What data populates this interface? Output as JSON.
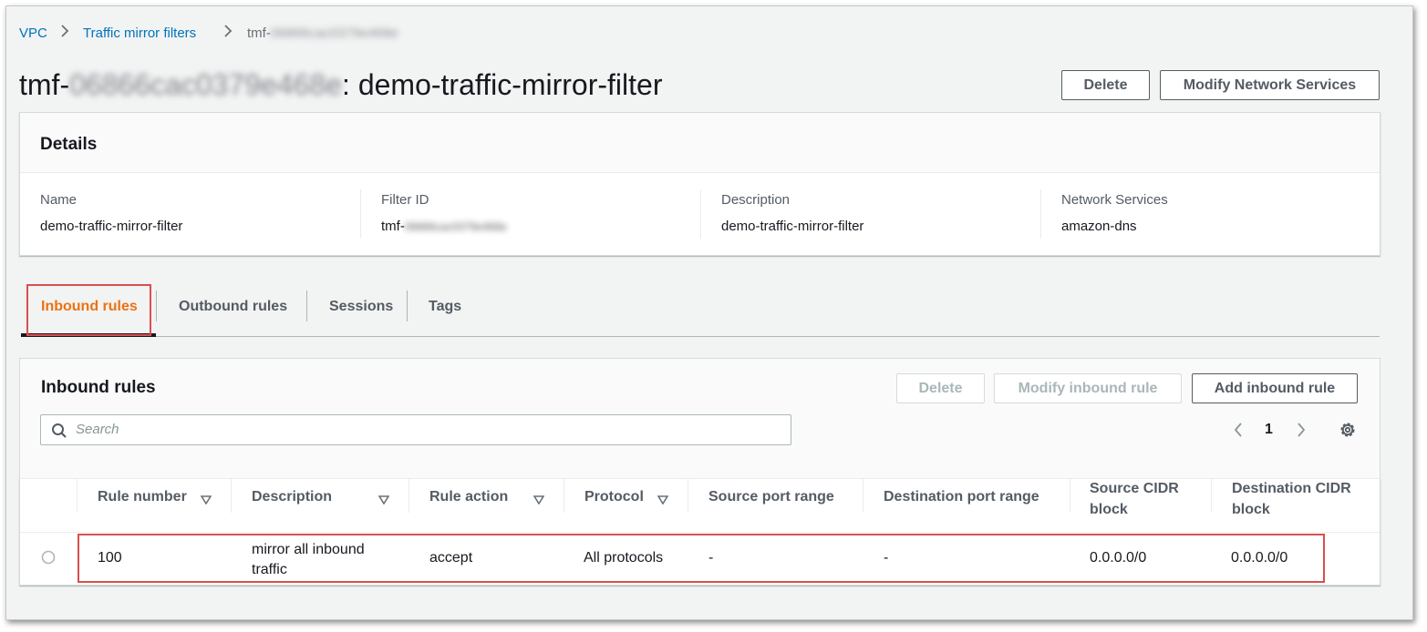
{
  "breadcrumb": {
    "items": [
      "VPC",
      "Traffic mirror filters"
    ],
    "current_prefix": "tmf-",
    "current_redacted": "06866cac0379e468e"
  },
  "header": {
    "title_prefix": "tmf-",
    "title_redacted": "06866cac0379e468e",
    "title_suffix": ": demo-traffic-mirror-filter",
    "delete_label": "Delete",
    "modify_label": "Modify Network Services"
  },
  "details": {
    "title": "Details",
    "fields": [
      {
        "label": "Name",
        "value": "demo-traffic-mirror-filter"
      },
      {
        "label": "Filter ID",
        "value": "tmf-",
        "redacted": "06866cac0379e468e"
      },
      {
        "label": "Description",
        "value": "demo-traffic-mirror-filter"
      },
      {
        "label": "Network Services",
        "value": "amazon-dns"
      }
    ]
  },
  "tabs": [
    {
      "label": "Inbound rules",
      "active": true
    },
    {
      "label": "Outbound rules",
      "active": false
    },
    {
      "label": "Sessions",
      "active": false
    },
    {
      "label": "Tags",
      "active": false
    }
  ],
  "rules": {
    "title": "Inbound rules",
    "delete_label": "Delete",
    "modify_label": "Modify inbound rule",
    "add_label": "Add inbound rule",
    "search_placeholder": "Search",
    "page_number": "1",
    "columns": [
      "Rule number",
      "Description",
      "Rule action",
      "Protocol",
      "Source port range",
      "Destination port range",
      "Source CIDR block",
      "Destination CIDR block"
    ],
    "rows": [
      {
        "rule_number": "100",
        "description_line1": "mirror all inbound",
        "description_line2": "traffic",
        "rule_action": "accept",
        "protocol": "All protocols",
        "source_port_range": "-",
        "destination_port_range": "-",
        "source_cidr": "0.0.0.0/0",
        "destination_cidr": "0.0.0.0/0"
      }
    ]
  },
  "colors": {
    "link": "#0073bb",
    "active_tab": "#ec7211",
    "highlight": "#d94f4f"
  },
  "icons": [
    "chevron-right-icon",
    "search-icon",
    "chevron-left-icon",
    "gear-icon",
    "sort-down-icon",
    "radio-icon"
  ]
}
